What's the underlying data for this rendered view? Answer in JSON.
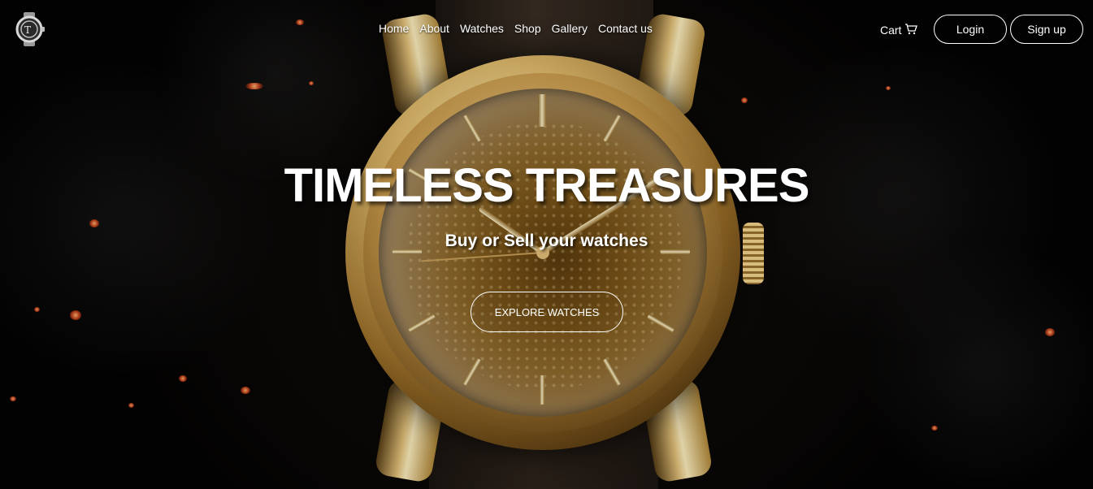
{
  "brand": {
    "logo_icon": "watch-logo-icon"
  },
  "nav": {
    "items": [
      {
        "label": "Home"
      },
      {
        "label": "About"
      },
      {
        "label": "Watches"
      },
      {
        "label": "Shop"
      },
      {
        "label": "Gallery"
      },
      {
        "label": "Contact us"
      }
    ]
  },
  "header_actions": {
    "cart_label": "Cart",
    "cart_icon": "cart-icon",
    "login_label": "Login",
    "signup_label": "Sign up"
  },
  "hero": {
    "title": "TIMELESS TREASURES",
    "subtitle": "Buy or Sell your watches",
    "cta_label": "EXPLORE WATCHES"
  },
  "colors": {
    "text": "#ffffff",
    "background": "#040303",
    "gold_accent": "#e2bd6e"
  }
}
